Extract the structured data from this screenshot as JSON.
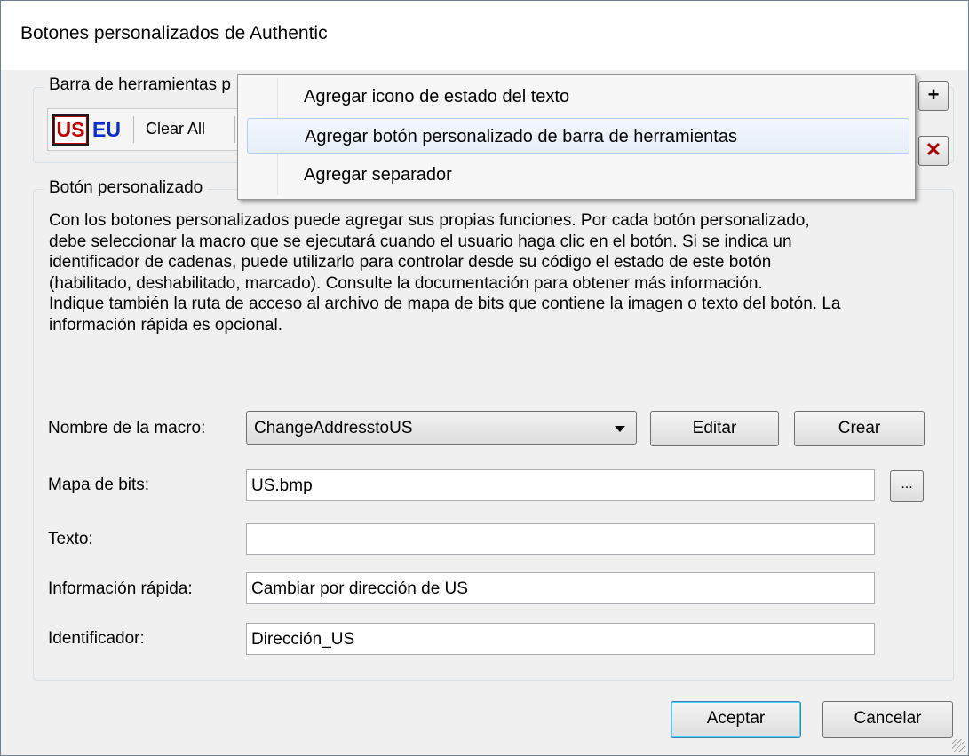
{
  "window": {
    "title": "Botones personalizados de Authentic"
  },
  "toolbar_group": {
    "legend": "Barra de herramientas p",
    "buttons": {
      "us": "US",
      "eu": "EU",
      "clear": "Clear All"
    },
    "add_button_glyph": "+",
    "delete_button_glyph": "✕"
  },
  "context_menu": {
    "items": [
      {
        "label": "Agregar icono de estado del texto"
      },
      {
        "label": "Agregar botón personalizado de barra de herramientas"
      },
      {
        "label": "Agregar separador"
      }
    ]
  },
  "custom_button_group": {
    "legend": "Botón personalizado",
    "description_lines": [
      "Con los botones personalizados puede agregar sus propias funciones. Por cada botón personalizado,",
      "debe seleccionar la macro que se ejecutará cuando el usuario haga clic en el botón. Si se indica un",
      "identificador de cadenas, puede utilizarlo para controlar desde su código el estado de este botón",
      "(habilitado, deshabilitado, marcado). Consulte la documentación para obtener más información.",
      "Indique también la ruta de acceso al archivo de mapa de bits que contiene la imagen o texto del botón. La",
      "información rápida es opcional."
    ],
    "fields": {
      "macro": {
        "label": "Nombre de la macro:",
        "value": "ChangeAddresstoUS"
      },
      "bitmap": {
        "label": "Mapa de bits:",
        "value": "US.bmp",
        "browse_label": "..."
      },
      "text": {
        "label": "Texto:",
        "value": ""
      },
      "tooltip": {
        "label": "Información rápida:",
        "value": "Cambiar por dirección de US"
      },
      "identifier": {
        "label": "Identificador:",
        "value": "Dirección_US"
      }
    },
    "edit_label": "Editar",
    "create_label": "Crear"
  },
  "footer": {
    "ok_label": "Aceptar",
    "cancel_label": "Cancelar"
  },
  "colors": {
    "us_red": "#c00000",
    "eu_blue": "#0a2bd0",
    "delete_red": "#b00000",
    "menu_highlight_border": "#aecff7"
  }
}
